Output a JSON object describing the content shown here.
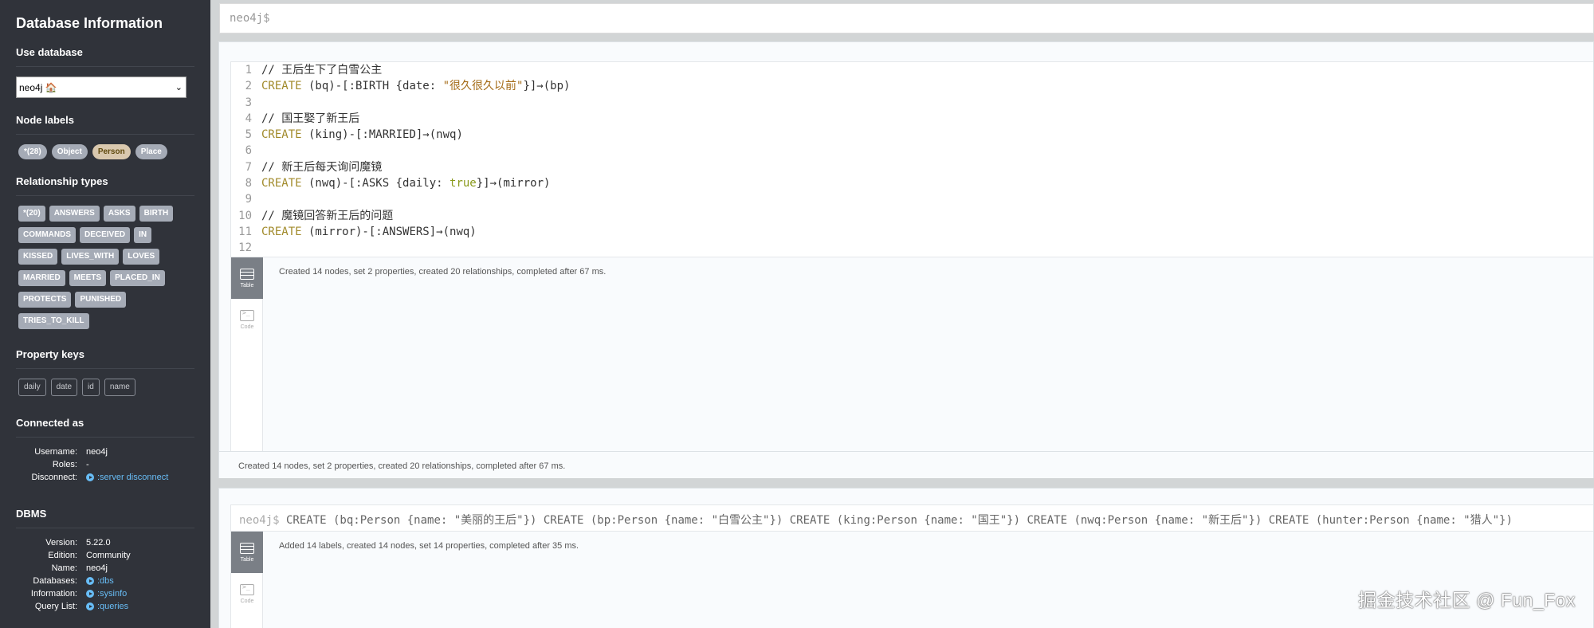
{
  "sidebar": {
    "title": "Database Information",
    "use_database": {
      "heading": "Use database",
      "selected": "neo4j 🏠"
    },
    "node_labels": {
      "heading": "Node labels",
      "items": [
        "*(28)",
        "Object",
        "Person",
        "Place"
      ]
    },
    "relationship_types": {
      "heading": "Relationship types",
      "items": [
        "*(20)",
        "ANSWERS",
        "ASKS",
        "BIRTH",
        "COMMANDS",
        "DECEIVED",
        "IN",
        "KISSED",
        "LIVES_WITH",
        "LOVES",
        "MARRIED",
        "MEETS",
        "PLACED_IN",
        "PROTECTS",
        "PUNISHED",
        "TRIES_TO_KILL"
      ]
    },
    "property_keys": {
      "heading": "Property keys",
      "items": [
        "daily",
        "date",
        "id",
        "name"
      ]
    },
    "connected_as": {
      "heading": "Connected as",
      "username_label": "Username:",
      "username": "neo4j",
      "roles_label": "Roles:",
      "roles": "-",
      "disconnect_label": "Disconnect:",
      "disconnect_link": ":server disconnect"
    },
    "dbms": {
      "heading": "DBMS",
      "version_label": "Version:",
      "version": "5.22.0",
      "edition_label": "Edition:",
      "edition": "Community",
      "name_label": "Name:",
      "name": "neo4j",
      "databases_label": "Databases:",
      "databases_link": ":dbs",
      "information_label": "Information:",
      "information_link": ":sysinfo",
      "query_list_label": "Query List:",
      "query_list_link": ":queries"
    }
  },
  "editor": {
    "prompt": "neo4j$"
  },
  "frame1": {
    "code_lines": [
      {
        "n": "1",
        "parts": [
          {
            "t": "// 王后生下了白雪公主",
            "c": "comment"
          }
        ]
      },
      {
        "n": "2",
        "parts": [
          {
            "t": "CREATE",
            "c": "kw"
          },
          {
            "t": " (bq)-[:BIRTH {date: ",
            "c": "punc"
          },
          {
            "t": "\"很久很久以前\"",
            "c": "str"
          },
          {
            "t": "}]→(bp)",
            "c": "punc"
          }
        ]
      },
      {
        "n": "3",
        "parts": []
      },
      {
        "n": "4",
        "parts": [
          {
            "t": "// 国王娶了新王后",
            "c": "comment"
          }
        ]
      },
      {
        "n": "5",
        "parts": [
          {
            "t": "CREATE",
            "c": "kw"
          },
          {
            "t": " (king)-[:MARRIED]→(nwq)",
            "c": "punc"
          }
        ]
      },
      {
        "n": "6",
        "parts": []
      },
      {
        "n": "7",
        "parts": [
          {
            "t": "// 新王后每天询问魔镜",
            "c": "comment"
          }
        ]
      },
      {
        "n": "8",
        "parts": [
          {
            "t": "CREATE",
            "c": "kw"
          },
          {
            "t": " (nwq)-[:ASKS {daily: ",
            "c": "punc"
          },
          {
            "t": "true",
            "c": "kw2"
          },
          {
            "t": "}]→(mirror)",
            "c": "punc"
          }
        ]
      },
      {
        "n": "9",
        "parts": []
      },
      {
        "n": "10",
        "parts": [
          {
            "t": "// 魔镜回答新王后的问题",
            "c": "comment"
          }
        ]
      },
      {
        "n": "11",
        "parts": [
          {
            "t": "CREATE",
            "c": "kw"
          },
          {
            "t": " (mirror)-[:ANSWERS]→(nwq)",
            "c": "punc"
          }
        ]
      },
      {
        "n": "12",
        "parts": []
      }
    ],
    "tab_table": "Table",
    "tab_code": "Code",
    "result_message": "Created 14 nodes, set 2 properties, created 20 relationships, completed after 67 ms.",
    "status_message": "Created 14 nodes, set 2 properties, created 20 relationships, completed after 67 ms."
  },
  "frame2": {
    "prompt": "neo4j$",
    "command": " CREATE (bq:Person {name: \"美丽的王后\"}) CREATE (bp:Person {name: \"白雪公主\"}) CREATE (king:Person {name: \"国王\"}) CREATE (nwq:Person {name: \"新王后\"}) CREATE (hunter:Person {name: \"猎人\"})",
    "tab_table": "Table",
    "tab_code": "Code",
    "result_message": "Added 14 labels, created 14 nodes, set 14 properties, completed after 35 ms."
  },
  "watermark": "掘金技术社区 @ Fun_Fox"
}
